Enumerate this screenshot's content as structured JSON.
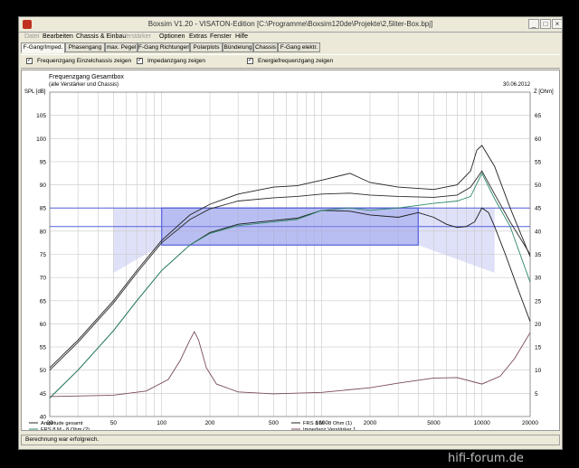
{
  "window": {
    "title": "Boxsim V1.20 - VISATON-Edition [C:\\Programme\\Boxsim120de\\Projekte\\2,5liter-Box.bpj]",
    "minimize": "_",
    "maximize": "□",
    "close": "×"
  },
  "menu": [
    {
      "label": "Datei",
      "enabled": false
    },
    {
      "label": "Bearbeiten",
      "enabled": true
    },
    {
      "label": "Chassis & Einbau",
      "enabled": true
    },
    {
      "label": "Verstärker",
      "enabled": false
    },
    {
      "label": "Optionen",
      "enabled": true
    },
    {
      "label": "Extras",
      "enabled": true
    },
    {
      "label": "Fenster",
      "enabled": true
    },
    {
      "label": "Hilfe",
      "enabled": true
    }
  ],
  "tabs": [
    {
      "label": "F-Gang/Imped.",
      "active": true
    },
    {
      "label": "Phasengang",
      "active": false
    },
    {
      "label": "max. Pegel",
      "active": false
    },
    {
      "label": "F-Gang Richtungen",
      "active": false
    },
    {
      "label": "Polarplots",
      "active": false
    },
    {
      "label": "Bündelung",
      "active": false
    },
    {
      "label": "Chassis",
      "active": false
    },
    {
      "label": "F-Gang elektr.",
      "active": false
    }
  ],
  "checkboxes": [
    {
      "label": "Frequenzgang Einzelchassis zeigen",
      "checked": true
    },
    {
      "label": "Impedanzgang zeigen",
      "checked": true
    },
    {
      "label": "Energiefrequenzgang zeigen",
      "checked": true
    }
  ],
  "checkmark": "✓",
  "plot": {
    "title": "Frequenzgang Gesamtbox",
    "subtitle": "(alle Verstärker und Chassis)",
    "date": "30.06.2012",
    "left_axis_title": "SPL [dB]",
    "right_axis_title": "Z [Ohm]"
  },
  "status": "Berechnung war erfolgreich.",
  "watermark": "hifi-forum.de",
  "colors": {
    "amplitude": "#2a2a2a",
    "frs_1": "#222222",
    "frs_2": "#2e8a6a",
    "energy": "#1a1a1a",
    "impedance": "#7a4a5a",
    "box": "#5560d8",
    "fill": "#c4c9f4"
  },
  "chart_data": {
    "type": "line",
    "xscale": "log",
    "xlim": [
      20,
      20000
    ],
    "ylim": [
      40,
      110
    ],
    "y2lim": [
      0,
      70
    ],
    "x_ticks": [
      20,
      50,
      100,
      200,
      500,
      1000,
      2000,
      5000,
      10000,
      20000
    ],
    "x_tick_labels": [
      "20",
      "50",
      "100",
      "200",
      "500",
      "1000",
      "2000",
      "5000",
      "10000",
      "20000"
    ],
    "y_ticks": [
      40,
      45,
      50,
      55,
      60,
      65,
      70,
      75,
      80,
      85,
      90,
      95,
      100,
      105
    ],
    "y_tick_labels": [
      "40",
      "45",
      "50",
      "55",
      "60",
      "65",
      "70",
      "75",
      "80",
      "85",
      "90",
      "95",
      "100",
      "105"
    ],
    "y2_ticks": [
      5,
      10,
      15,
      20,
      25,
      30,
      35,
      40,
      45,
      50,
      55,
      60,
      65
    ],
    "y2_tick_labels": [
      "5",
      "10",
      "15",
      "20",
      "25",
      "30",
      "35",
      "40",
      "45",
      "50",
      "55",
      "60",
      "65"
    ],
    "grid": true,
    "legend_position": "bottom",
    "series": [
      {
        "name": "Amplitude gesamt",
        "color": "#2a2a2a",
        "axis": "left",
        "x": [
          20,
          30,
          50,
          70,
          100,
          150,
          200,
          300,
          500,
          700,
          1000,
          1500,
          2000,
          3000,
          5000,
          7000,
          8500,
          10000,
          12000,
          15000,
          20000
        ],
        "y": [
          50,
          56,
          64.5,
          71,
          77.5,
          82.5,
          84.8,
          86.5,
          87.2,
          87.5,
          88,
          88.2,
          87.8,
          87.5,
          87.3,
          87.8,
          89.5,
          93,
          88,
          82,
          75
        ]
      },
      {
        "name": "FRS 8 M - 8 Ohm (1)",
        "color": "#222222",
        "axis": "left",
        "x": [
          20,
          30,
          50,
          70,
          100,
          150,
          200,
          300,
          500,
          700,
          1000,
          1500,
          2000,
          3000,
          5000,
          7000,
          8500,
          9300,
          10000,
          12000,
          15000,
          20000
        ],
        "y": [
          50.5,
          56.5,
          65,
          71.5,
          78,
          83.5,
          85.8,
          88,
          89.5,
          89.8,
          91,
          92.5,
          90.5,
          89.5,
          89,
          90,
          93,
          97.5,
          98.5,
          94,
          85,
          74.5
        ]
      },
      {
        "name": "FRS 8 M - 8 Ohm (2)",
        "color": "#2e8a6a",
        "axis": "left",
        "x": [
          20,
          30,
          50,
          70,
          100,
          150,
          200,
          300,
          500,
          700,
          1000,
          1500,
          2000,
          3000,
          5000,
          7000,
          8500,
          10000,
          12000,
          15000,
          20000
        ],
        "y": [
          44,
          50,
          58.5,
          65,
          71.5,
          77,
          79.5,
          81.2,
          82,
          82.5,
          84.5,
          85,
          84.5,
          85,
          86,
          86.5,
          87.5,
          92.5,
          87,
          81,
          69
        ]
      },
      {
        "name": "Energiefrequenzgang",
        "color": "#1a1a1a",
        "axis": "left",
        "x": [
          20,
          30,
          50,
          70,
          100,
          150,
          200,
          300,
          500,
          700,
          1000,
          1500,
          2000,
          3000,
          4000,
          5000,
          6000,
          7000,
          8000,
          9000,
          10000,
          11000,
          12000,
          14000,
          17000,
          20000
        ],
        "y": [
          44,
          50,
          58.5,
          65,
          71.5,
          77,
          79.7,
          81.5,
          82.3,
          82.8,
          84.5,
          84.3,
          83.5,
          83,
          84,
          83,
          81.5,
          80.8,
          81,
          82,
          85,
          84,
          81,
          75,
          67,
          60.5
        ]
      },
      {
        "name": "Impedanz Verstärker 1",
        "color": "#7a4a5a",
        "axis": "right",
        "x": [
          20,
          50,
          80,
          110,
          130,
          150,
          160,
          170,
          190,
          220,
          300,
          500,
          1000,
          2000,
          3000,
          5000,
          7000,
          10000,
          13000,
          16000,
          20000
        ],
        "y": [
          4.3,
          4.6,
          5.5,
          8,
          12,
          16.5,
          18.3,
          16.5,
          10.5,
          7,
          5.3,
          4.9,
          5.2,
          6.2,
          7.2,
          8.3,
          8.4,
          7,
          8.7,
          12.5,
          18.1
        ]
      }
    ],
    "target_box": {
      "x": [
        100,
        4000
      ],
      "y": [
        77,
        85
      ]
    },
    "reference_lines": [
      85,
      81
    ],
    "shaded_band": {
      "x": [
        50,
        12000
      ]
    }
  }
}
